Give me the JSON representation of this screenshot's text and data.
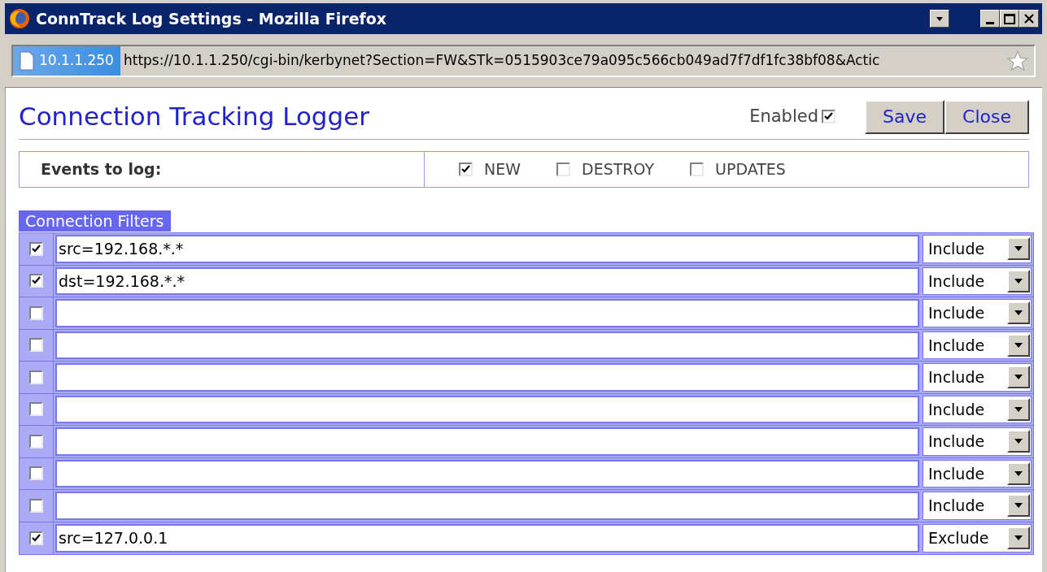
{
  "window": {
    "title": "ConnTrack Log Settings - Mozilla Firefox"
  },
  "address_bar": {
    "site": "10.1.1.250",
    "url": "https://10.1.1.250/cgi-bin/kerbynet?Section=FW&STk=0515903ce79a095c566cb049ad7f7df1fc38bf08&Actic"
  },
  "page": {
    "title": "Connection Tracking Logger",
    "enabled": {
      "label": "Enabled",
      "checked": true
    },
    "buttons": [
      "Save",
      "Close"
    ]
  },
  "events": {
    "label": "Events to log:",
    "options": [
      {
        "label": "NEW",
        "checked": true
      },
      {
        "label": "DESTROY",
        "checked": false
      },
      {
        "label": "UPDATES",
        "checked": false
      }
    ]
  },
  "filters": {
    "title": "Connection Filters",
    "rows": [
      {
        "checked": true,
        "value": "src=192.168.*.*",
        "action": "Include"
      },
      {
        "checked": true,
        "value": "dst=192.168.*.*",
        "action": "Include"
      },
      {
        "checked": false,
        "action": "Include"
      },
      {
        "checked": false,
        "action": "Include"
      },
      {
        "checked": false,
        "action": "Include"
      },
      {
        "checked": false,
        "action": "Include"
      },
      {
        "checked": false,
        "action": "Include"
      },
      {
        "checked": false,
        "action": "Include"
      },
      {
        "checked": false,
        "action": "Include"
      },
      {
        "checked": true,
        "value": "src=127.0.0.1",
        "action": "Exclude"
      }
    ]
  }
}
